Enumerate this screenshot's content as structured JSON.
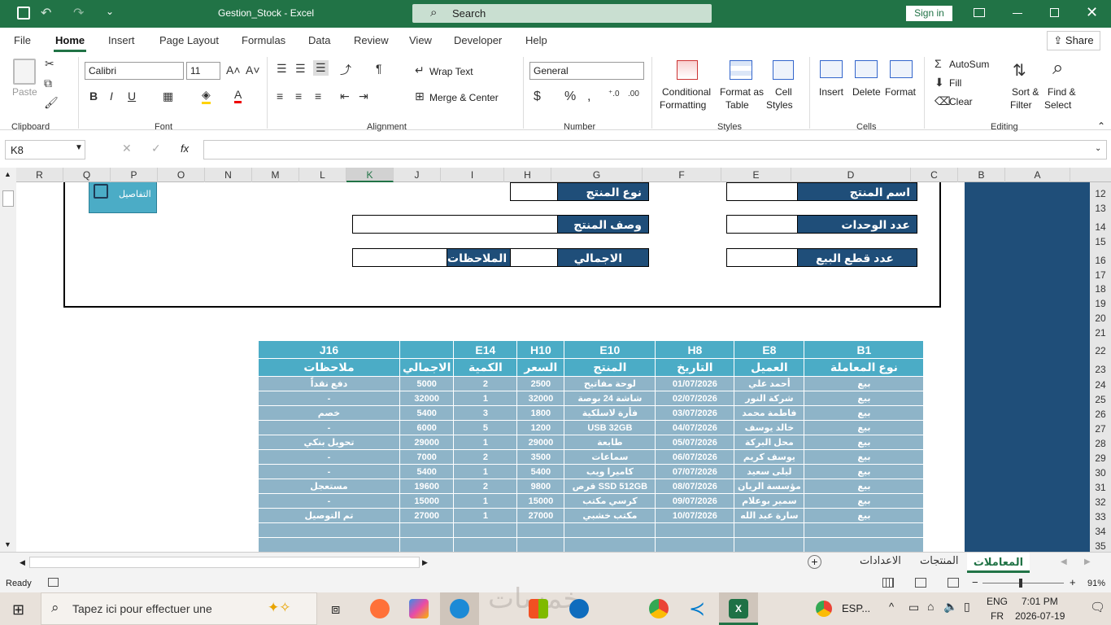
{
  "window": {
    "title": "Gestion_Stock  -  Excel",
    "search_label": "Search",
    "signin_label": "Sign in"
  },
  "menu": [
    "File",
    "Home",
    "Insert",
    "Page Layout",
    "Formulas",
    "Data",
    "Review",
    "View",
    "Developer",
    "Help"
  ],
  "share_label": "Share",
  "ribbon": {
    "clipboard": {
      "paste": "Paste",
      "group": "Clipboard"
    },
    "font": {
      "name": "Calibri",
      "size": "11",
      "group": "Font"
    },
    "alignment": {
      "wrap": "Wrap Text",
      "merge": "Merge & Center",
      "group": "Alignment"
    },
    "number": {
      "format": "General",
      "group": "Number"
    },
    "styles": {
      "conditional": "Conditional",
      "conditional2": "Formatting",
      "format_as": "Format as",
      "format_as2": "Table",
      "cell": "Cell",
      "cell2": "Styles",
      "group": "Styles"
    },
    "cells": {
      "insert": "Insert",
      "delete": "Delete",
      "format": "Format",
      "group": "Cells"
    },
    "editing": {
      "autosum": "AutoSum",
      "fill": "Fill",
      "clear": "Clear",
      "sort": "Sort &",
      "sort2": "Filter",
      "find": "Find &",
      "find2": "Select",
      "group": "Editing"
    }
  },
  "formula_bar": {
    "name_box": "K8",
    "fx": "fx",
    "value": ""
  },
  "columns": [
    "R",
    "Q",
    "P",
    "O",
    "N",
    "M",
    "L",
    "K",
    "J",
    "I",
    "H",
    "G",
    "F",
    "E",
    "D",
    "C",
    "B",
    "A"
  ],
  "selected_column": "K",
  "rows": [
    "12",
    "13",
    "14",
    "15",
    "16",
    "17",
    "18",
    "19",
    "20",
    "21",
    "22",
    "23",
    "24",
    "25",
    "26",
    "27",
    "28",
    "29",
    "30",
    "31",
    "32",
    "33",
    "34",
    "35"
  ],
  "form": {
    "button_label": "التفاصيل",
    "product_type": "نوع المنتج",
    "product_name": "اسم المنتج",
    "product_desc": "وصف المنتج",
    "units_available": "عدد الوحدات الموجودة",
    "total": "الاجمالي",
    "notes": "الملاحظات",
    "units_sold": "عدد قطع البيع"
  },
  "table": {
    "refs": [
      "J16",
      "",
      "E14",
      "H10",
      "E10",
      "H8",
      "E8",
      "B1"
    ],
    "headers": [
      "ملاحظات",
      "الاجمالي",
      "الكمية",
      "السعر",
      "المنتج",
      "التاريخ",
      "العميل",
      "نوع المعاملة"
    ],
    "rows": [
      [
        "دفع نقداً",
        "5000",
        "2",
        "2500",
        "لوحة مفاتيح",
        "01/07/2026",
        "أحمد علي",
        "بيع"
      ],
      [
        "-",
        "32000",
        "1",
        "32000",
        "شاشة 24 بوصة",
        "02/07/2026",
        "شركة النور",
        "بيع"
      ],
      [
        "خصم",
        "5400",
        "3",
        "1800",
        "فأرة لاسلكية",
        "03/07/2026",
        "فاطمة محمد",
        "بيع"
      ],
      [
        "-",
        "6000",
        "5",
        "1200",
        "USB 32GB",
        "04/07/2026",
        "خالد يوسف",
        "بيع"
      ],
      [
        "تحويل بنكي",
        "29000",
        "1",
        "29000",
        "طابعة",
        "05/07/2026",
        "محل البركة",
        "بيع"
      ],
      [
        "-",
        "7000",
        "2",
        "3500",
        "سماعات",
        "06/07/2026",
        "يوسف كريم",
        "بيع"
      ],
      [
        "-",
        "5400",
        "1",
        "5400",
        "كاميرا ويب",
        "07/07/2026",
        "ليلى سعيد",
        "بيع"
      ],
      [
        "مستعجل",
        "19600",
        "2",
        "9800",
        "قرص SSD 512GB",
        "08/07/2026",
        "مؤسسة الريان",
        "بيع"
      ],
      [
        "-",
        "15000",
        "1",
        "15000",
        "كرسي مكتب",
        "09/07/2026",
        "سمير بوعلام",
        "بيع"
      ],
      [
        "تم التوصيل",
        "27000",
        "1",
        "27000",
        "مكتب خشبي",
        "10/07/2026",
        "سارة عبد الله",
        "بيع"
      ],
      [
        "",
        "",
        "",
        "",
        "",
        "",
        "",
        ""
      ],
      [
        "",
        "",
        "",
        "",
        "",
        "",
        "",
        ""
      ]
    ]
  },
  "sheets": {
    "active": "المعاملات",
    "others": [
      "المنتجات",
      "الاعدادات"
    ]
  },
  "status": {
    "ready": "Ready",
    "zoom": "91%"
  },
  "taskbar": {
    "search": "Tapez ici pour effectuer une",
    "lang1": "ENG",
    "lang2": "FR",
    "time": "7:01 PM",
    "date": "2026-07-19",
    "esp": "ESP..."
  },
  "colors": {
    "excel_green": "#217346",
    "form_label": "#1f4e79",
    "table_header": "#4bacc6",
    "table_row": "#8eb4c8"
  }
}
